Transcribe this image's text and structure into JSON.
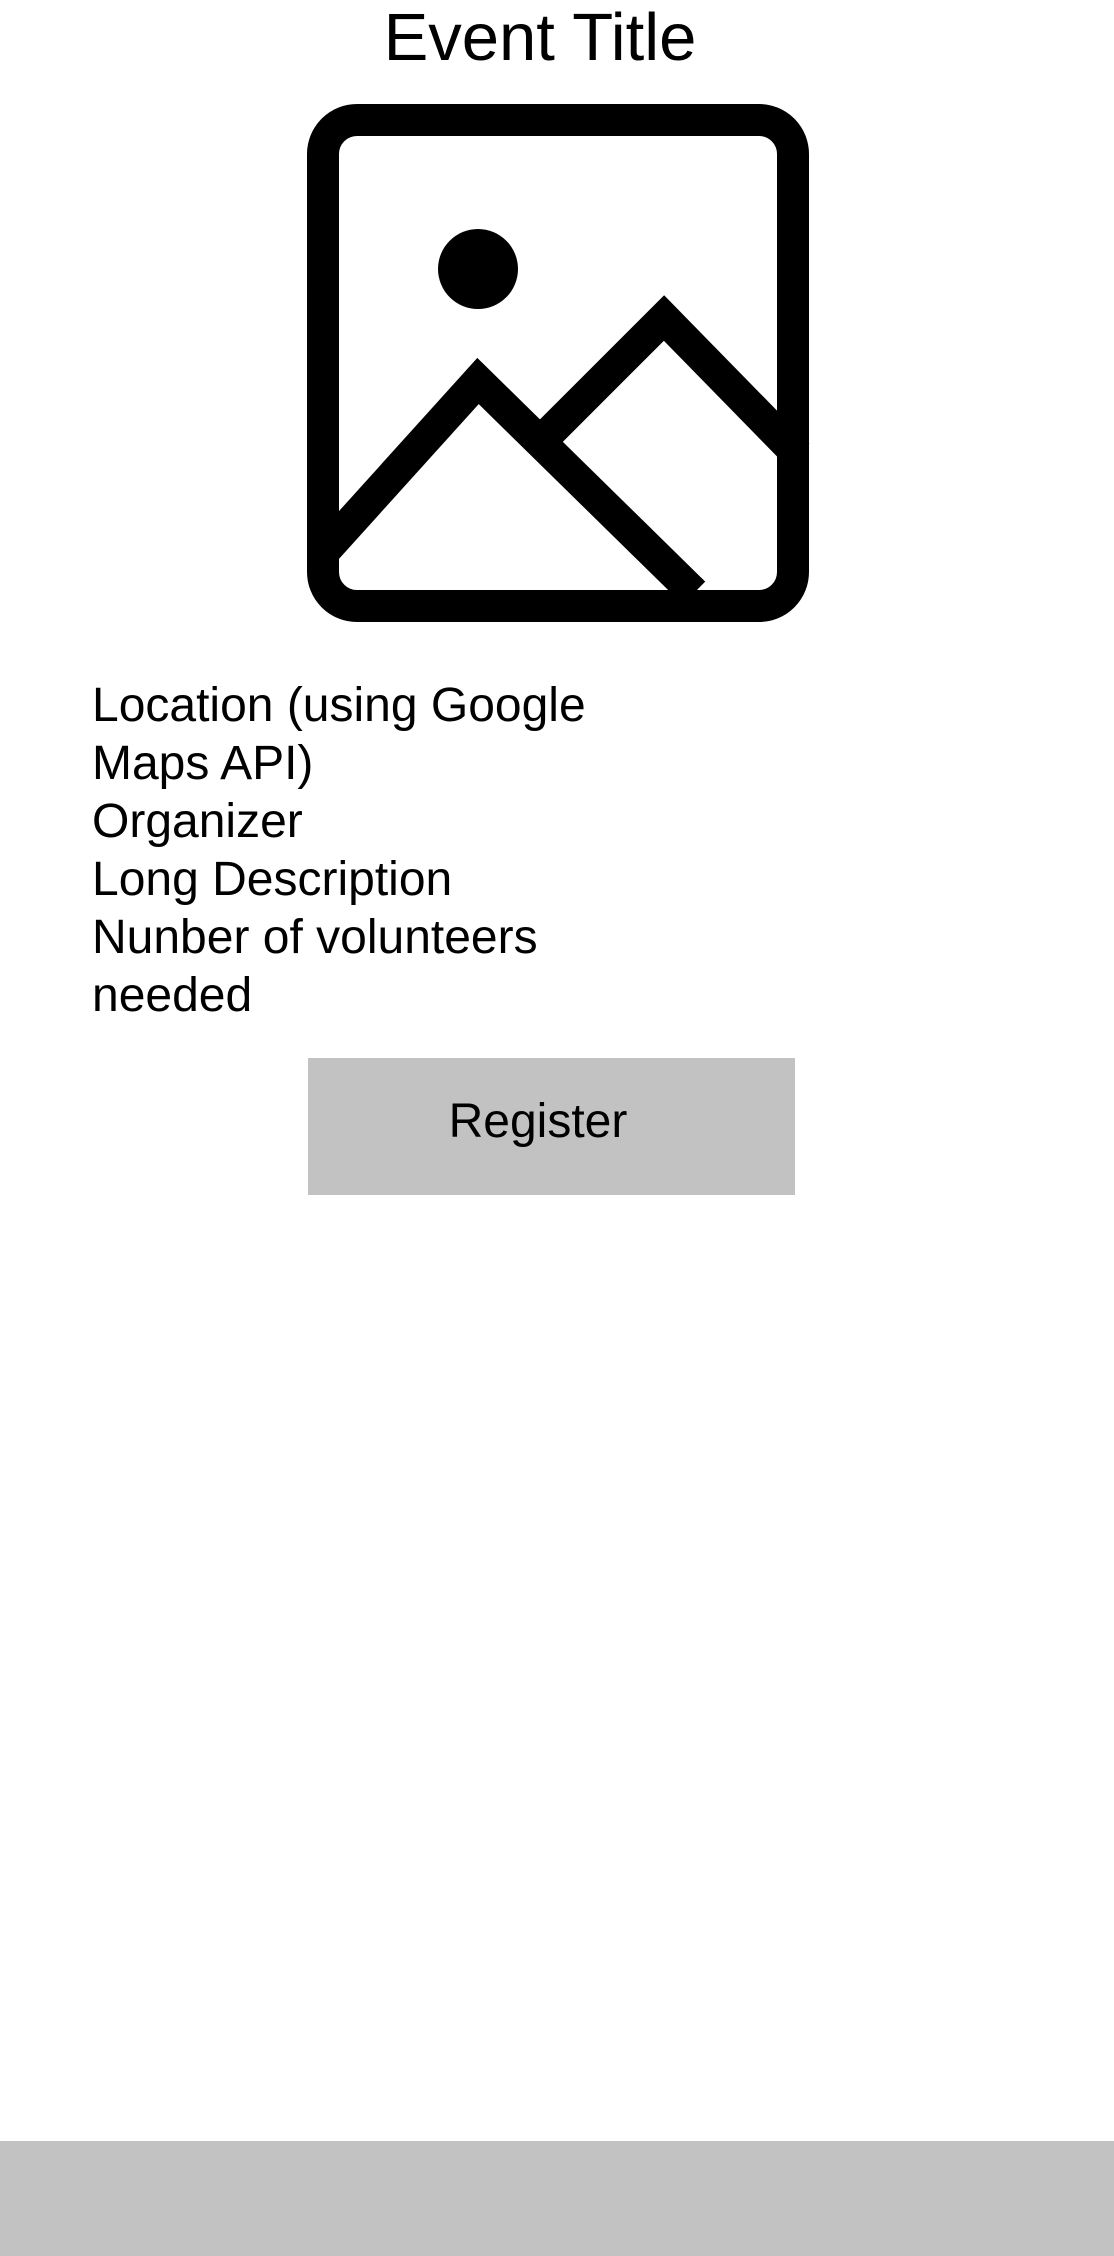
{
  "header": {
    "title": "Event Title"
  },
  "image": {
    "icon": "image-placeholder-icon"
  },
  "details": {
    "location": "Location (using Google Maps API)",
    "organizer": "Organizer",
    "description": "Long Description",
    "volunteers": "Nunber of volunteers needed"
  },
  "actions": {
    "register_label": "Register"
  },
  "colors": {
    "button_bg": "#c2c2c2",
    "bottom_bar_bg": "#c2c2c2",
    "text": "#000000",
    "background": "#ffffff"
  }
}
